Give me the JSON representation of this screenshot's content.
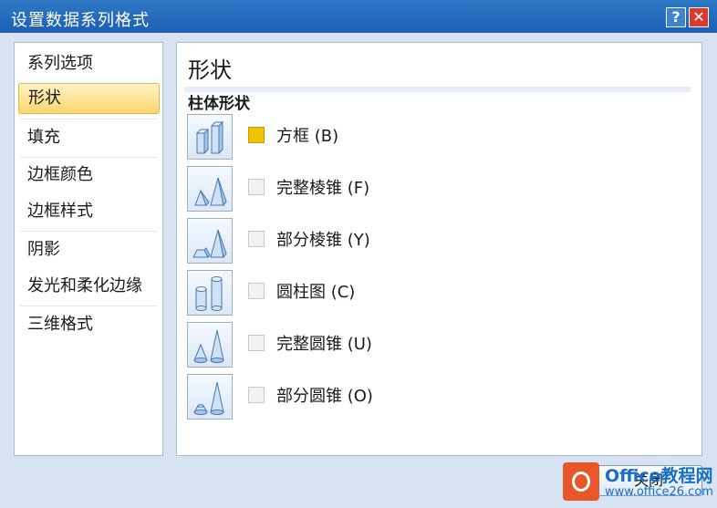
{
  "window": {
    "title": "设置数据系列格式",
    "help_label": "?",
    "close_label": "✕"
  },
  "sidebar": {
    "items": [
      {
        "label": "系列选项"
      },
      {
        "label": "形状",
        "selected": true
      },
      {
        "label": "填充"
      },
      {
        "label": "边框颜色"
      },
      {
        "label": "边框样式"
      },
      {
        "label": "阴影"
      },
      {
        "label": "发光和柔化边缘"
      },
      {
        "label": "三维格式"
      }
    ]
  },
  "main": {
    "heading": "形状",
    "section_label": "柱体形状",
    "options": [
      {
        "label": "方框 (B)",
        "icon": "box-shape-icon",
        "checked": true
      },
      {
        "label": "完整棱锥 (F)",
        "icon": "full-pyramid-shape-icon",
        "checked": false
      },
      {
        "label": "部分棱锥 (Y)",
        "icon": "partial-pyramid-shape-icon",
        "checked": false
      },
      {
        "label": "圆柱图 (C)",
        "icon": "cylinder-shape-icon",
        "checked": false
      },
      {
        "label": "完整圆锥 (U)",
        "icon": "full-cone-shape-icon",
        "checked": false
      },
      {
        "label": "部分圆锥 (O)",
        "icon": "partial-cone-shape-icon",
        "checked": false
      }
    ]
  },
  "footer": {
    "close_button_label": "关闭"
  },
  "watermark": {
    "line1": "Office教程网",
    "line2": "www.office26.com"
  },
  "colors": {
    "titlebar": "#1e5fb3",
    "selected_item": "#fbd66f",
    "checked_box": "#f2c200"
  }
}
